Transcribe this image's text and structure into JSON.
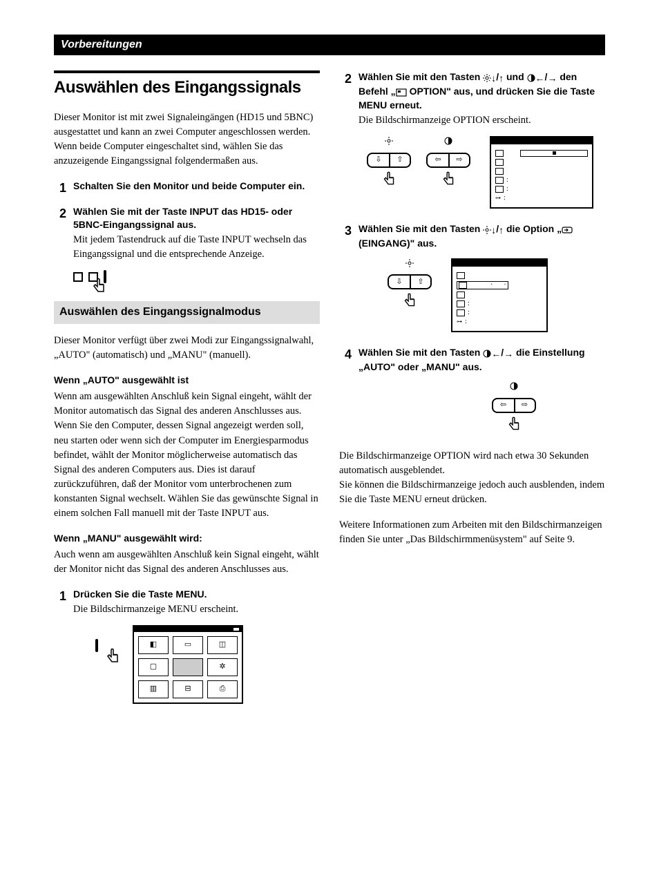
{
  "header": "Vorbereitungen",
  "h1": "Auswählen des Eingangssignals",
  "intro": "Dieser Monitor ist mit zwei Signaleingängen (HD15 und 5BNC) ausgestattet und kann an zwei Computer angeschlossen werden. Wenn beide Computer eingeschaltet sind, wählen Sie das anzuzeigende Eingangssignal folgendermaßen aus.",
  "left_steps": {
    "s1": {
      "num": "1",
      "title": "Schalten Sie den Monitor und beide Computer ein."
    },
    "s2": {
      "num": "2",
      "title": "Wählen Sie mit der Taste INPUT das HD15- oder 5BNC-Eingangssignal aus.",
      "text": "Mit jedem Tastendruck auf die Taste INPUT wechseln das Eingangssignal und die entsprechende Anzeige."
    }
  },
  "sub_heading": "Auswählen des Eingangssignalmodus",
  "sub_intro": "Dieser Monitor verfügt über zwei Modi zur Eingangssignalwahl, „AUTO\" (automatisch) und „MANU\" (manuell).",
  "auto": {
    "title": "Wenn „AUTO\" ausgewählt ist",
    "text": "Wenn am ausgewählten Anschluß kein Signal eingeht, wählt der Monitor automatisch das Signal des anderen Anschlusses aus. Wenn Sie den Computer, dessen Signal angezeigt werden soll, neu starten oder wenn sich der Computer im Energiesparmodus befindet, wählt der Monitor möglicherweise automatisch das Signal des anderen Computers aus. Dies ist darauf zurückzuführen, daß der Monitor vom unterbrochenen zum konstanten Signal wechselt. Wählen Sie das gewünschte Signal in einem solchen Fall manuell mit der Taste INPUT aus."
  },
  "manu": {
    "title": "Wenn „MANU\" ausgewählt wird:",
    "text": "Auch wenn am ausgewählten Anschluß kein Signal eingeht, wählt der Monitor nicht das Signal des anderen Anschlusses aus."
  },
  "bottom_step": {
    "num": "1",
    "title": "Drücken Sie die Taste MENU.",
    "text": "Die Bildschirmanzeige MENU erscheint."
  },
  "right_steps": {
    "s2": {
      "num": "2",
      "title_before": "Wählen Sie mit den Tasten ",
      "title_mid": " und ",
      "title_after": " den Befehl „",
      "title_end": " OPTION\" aus, und drücken Sie die Taste MENU erneut.",
      "text": "Die Bildschirmanzeige OPTION erscheint."
    },
    "s3": {
      "num": "3",
      "title_before": "Wählen Sie mit den Tasten ",
      "title_mid": " die Option „",
      "title_after": " (EINGANG)\" aus."
    },
    "s4": {
      "num": "4",
      "title_before": "Wählen Sie mit den Tasten ",
      "title_after": " die Einstellung „AUTO\" oder „MANU\" aus."
    }
  },
  "closing": {
    "p1": "Die Bildschirmanzeige OPTION wird nach etwa 30 Sekunden automatisch ausgeblendet.",
    "p2": "Sie können die Bildschirmanzeige jedoch auch ausblenden, indem Sie die Taste MENU erneut drücken.",
    "p3": "Weitere Informationen zum Arbeiten mit den Bildschirmanzeigen finden Sie unter „Das Bildschirmmenüsystem\" auf Seite 9."
  },
  "icons": {
    "sun": "brightness-icon",
    "moon": "contrast-icon",
    "down": "↓",
    "up": "↑",
    "left": "←",
    "right": "→",
    "option": "option-icon",
    "input": "input-icon"
  }
}
